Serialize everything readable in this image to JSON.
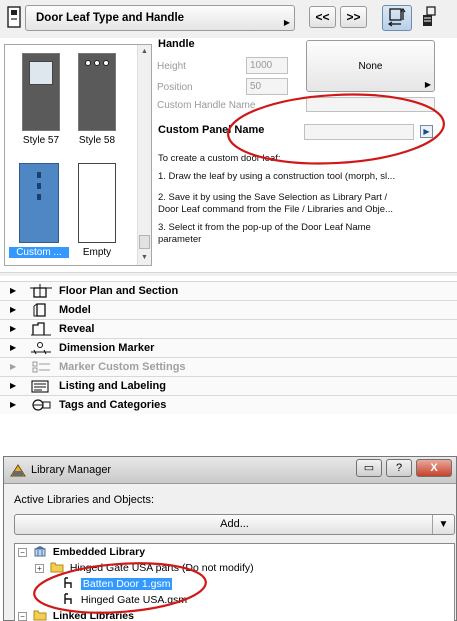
{
  "toolbar": {
    "title": "Door Leaf Type and Handle",
    "prev_label": "<<",
    "next_label": ">>"
  },
  "styles": [
    {
      "label": "Style 57",
      "selected": false
    },
    {
      "label": "Style 58",
      "selected": false
    },
    {
      "label": "Custom ...",
      "selected": true
    },
    {
      "label": "Empty",
      "selected": false
    }
  ],
  "handle": {
    "title": "Handle",
    "height_label": "Height",
    "height_value": "1000",
    "position_label": "Position",
    "position_value": "50",
    "custom_handle_label": "Custom Handle Name",
    "handle_button_label": "None"
  },
  "custom_panel": {
    "label": "Custom Panel Name",
    "value": ""
  },
  "instructions": {
    "intro": "To create a custom door leaf:",
    "step1": "1. Draw the leaf by using a construction tool (morph, sl...",
    "step2a": "2. Save it by using the Save Selection as Library Part /",
    "step2b": "Door Leaf command from the File / Libraries and Obje...",
    "step3a": "3. Select it from the pop-up of the Door Leaf Name",
    "step3b": "parameter"
  },
  "sections": [
    {
      "label": "Floor Plan and Section",
      "icon": "floor-plan-icon",
      "enabled": true
    },
    {
      "label": "Model",
      "icon": "model-icon",
      "enabled": true
    },
    {
      "label": "Reveal",
      "icon": "reveal-icon",
      "enabled": true
    },
    {
      "label": "Dimension Marker",
      "icon": "dimension-marker-icon",
      "enabled": true
    },
    {
      "label": "Marker Custom Settings",
      "icon": "marker-settings-icon",
      "enabled": false
    },
    {
      "label": "Listing and Labeling",
      "icon": "listing-icon",
      "enabled": true
    },
    {
      "label": "Tags and Categories",
      "icon": "tags-icon",
      "enabled": true
    }
  ],
  "library_manager": {
    "title": "Library Manager",
    "active_label": "Active Libraries and Objects:",
    "add_label": "Add...",
    "help_label": "?",
    "close_label": "X",
    "tree": [
      {
        "label": "Embedded Library",
        "bold": true
      },
      {
        "label": "Hinged Gate USA parts (Do not modify)",
        "bold": false
      },
      {
        "label": "Batten Door 1.gsm",
        "bold": false,
        "selected": true
      },
      {
        "label": "Hinged Gate USA.gsm",
        "bold": false
      },
      {
        "label": "Linked Libraries",
        "bold": true
      }
    ]
  },
  "colors": {
    "selection": "#3399ff",
    "annotation": "#d01818",
    "panel_bg": "#f0f0f0"
  }
}
